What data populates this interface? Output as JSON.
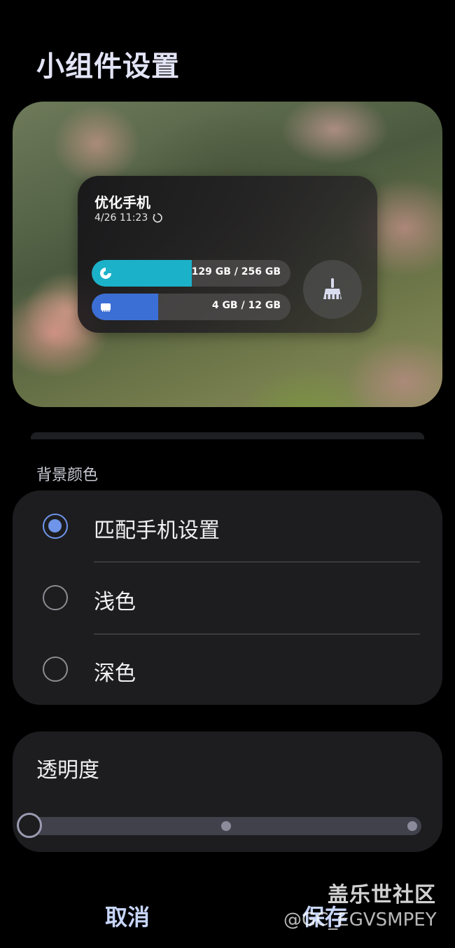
{
  "page": {
    "title": "小组件设置"
  },
  "widget": {
    "title": "优化手机",
    "time": "4/26 11:23",
    "storage": {
      "text": "129 GB / 256 GB",
      "fill_fraction": 0.504,
      "color": "#1bb1c9"
    },
    "memory": {
      "text": "4 GB / 12 GB",
      "fill_fraction": 0.333,
      "color": "#3c6fd6"
    },
    "icons": {
      "refresh": "refresh-icon",
      "storage": "pie-chart-icon",
      "memory": "memory-chip-icon",
      "clean": "broom-icon"
    }
  },
  "background": {
    "label": "背景颜色",
    "options": [
      {
        "label": "匹配手机设置",
        "selected": true
      },
      {
        "label": "浅色",
        "selected": false
      },
      {
        "label": "深色",
        "selected": false
      }
    ]
  },
  "transparency": {
    "label": "透明度",
    "level": 0
  },
  "buttons": {
    "cancel": "取消",
    "save": "保存"
  },
  "watermark": {
    "line1": "盖乐世社区",
    "line2": "@GC_EGVSMPEY"
  },
  "colors": {
    "accent": "#6f95ea",
    "button_text": "#c8d6fa"
  }
}
